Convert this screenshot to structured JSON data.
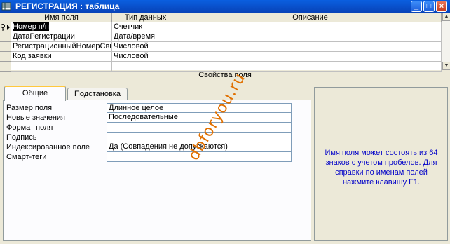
{
  "window": {
    "title": "РЕГИСТРАЦИЯ : таблица",
    "buttons": {
      "minimize": "_",
      "maximize": "□",
      "close": "×"
    }
  },
  "table": {
    "columns": [
      "Имя поля",
      "Тип данных",
      "Описание"
    ],
    "rows": [
      {
        "name": "Номер п/п",
        "type": "Счетчик",
        "description": "",
        "key": true,
        "active": true
      },
      {
        "name": "ДатаРегистрации",
        "type": "Дата/время",
        "description": ""
      },
      {
        "name": "РегистрационныйНомерСви",
        "type": "Числовой",
        "description": ""
      },
      {
        "name": "Код заявки",
        "type": "Числовой",
        "description": ""
      },
      {
        "name": "",
        "type": "",
        "description": ""
      }
    ]
  },
  "properties": {
    "caption": "Свойства поля",
    "tabs": [
      "Общие",
      "Подстановка"
    ],
    "active_tab": "Общие",
    "items": [
      {
        "label": "Размер поля",
        "value": "Длинное целое"
      },
      {
        "label": "Новые значения",
        "value": "Последовательные"
      },
      {
        "label": "Формат поля",
        "value": ""
      },
      {
        "label": "Подпись",
        "value": ""
      },
      {
        "label": "Индексированное поле",
        "value": "Да (Совпадения не допускаются)"
      },
      {
        "label": "Смарт-теги",
        "value": ""
      }
    ]
  },
  "watermark": "dbforyou.ru",
  "help": {
    "text": "Имя поля может состоять из 64 знаков с учетом пробелов.  Для справки по именам полей нажмите клавишу F1."
  },
  "colors": {
    "titlebar": "#0a5fe0",
    "help_text": "#0000c8",
    "watermark": "#e07000",
    "tab_highlight": "#ffc83c"
  }
}
